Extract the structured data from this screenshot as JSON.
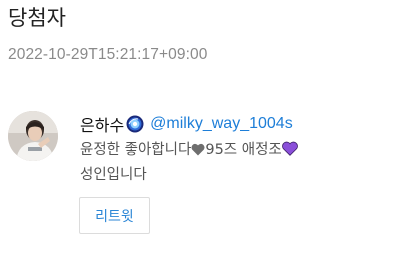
{
  "page": {
    "title": "당첨자",
    "timestamp": "2022-10-29T15:21:17+09:00"
  },
  "tweet": {
    "display_name": "은하수",
    "badge_icon": "swirl-badge-icon",
    "handle": "@milky_way_1004s",
    "line1_part1": "윤정한 좋아합니다",
    "heart1_icon": "gray-heart-icon",
    "heart1_color": "#6e6e6e",
    "line1_part2": "95즈 애정조",
    "heart2_icon": "purple-heart-icon",
    "heart2_color": "#8a4fd9",
    "line2": "성인입니다"
  },
  "actions": {
    "retweet_label": "리트윗"
  },
  "colors": {
    "link": "#1d7ed8",
    "button_text": "#2b86d6"
  }
}
